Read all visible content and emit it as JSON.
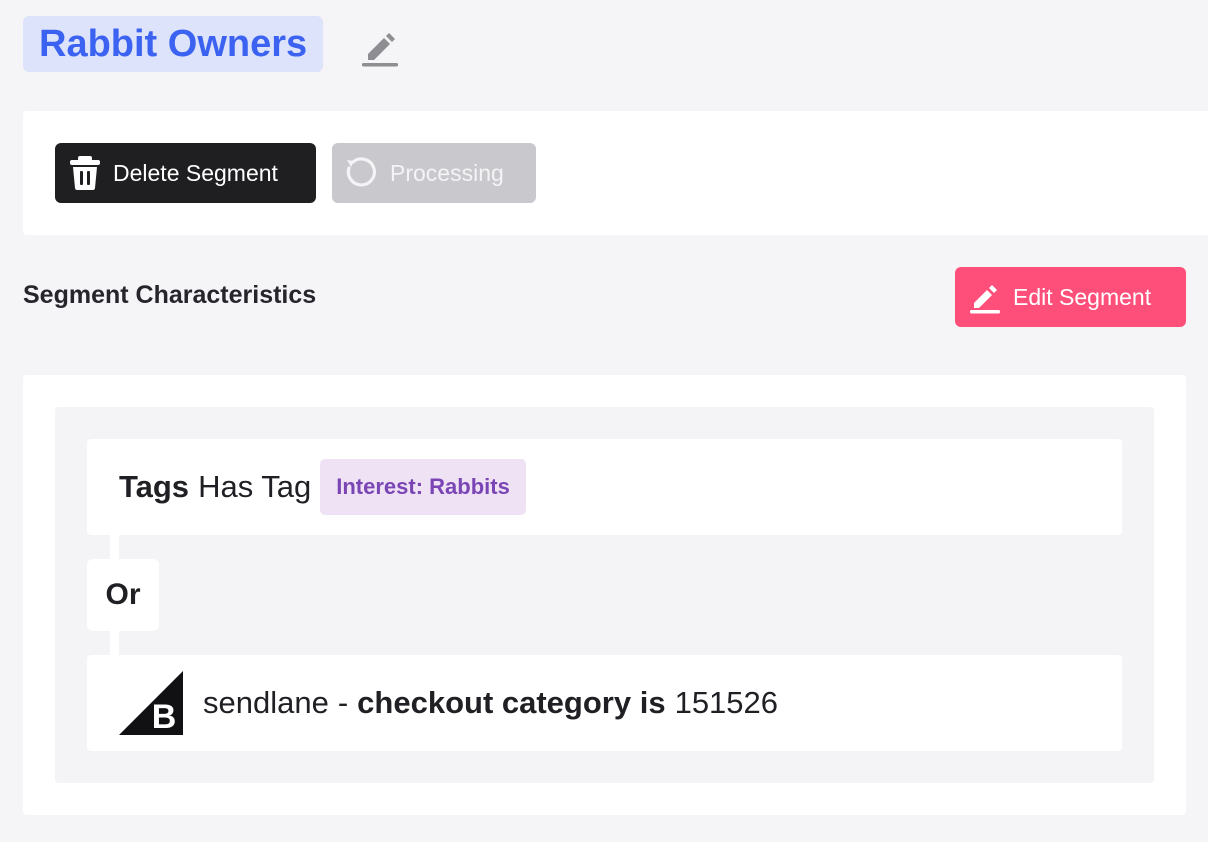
{
  "header": {
    "segment_name": "Rabbit Owners",
    "edit_name_icon": "pencil-underline-icon"
  },
  "actions": {
    "delete_label": "Delete Segment",
    "delete_icon": "trash-icon",
    "processing_label": "Processing",
    "processing_icon": "refresh-icon"
  },
  "characteristics": {
    "title": "Segment Characteristics",
    "edit_label": "Edit Segment",
    "edit_icon": "pencil-underline-icon",
    "rules": [
      {
        "field": "Tags",
        "operator": "Has Tag",
        "tag": "Interest: Rabbits"
      },
      {
        "integration_icon": "bigcommerce-logo",
        "source": "sendlane",
        "separator": "-",
        "condition": "checkout category is",
        "value": "151526"
      }
    ],
    "join_label": "Or"
  },
  "colors": {
    "page_bg": "#f5f4f7",
    "title_pill_bg": "#dde3fb",
    "title_text": "#3b62f0",
    "delete_bg": "#1f1f22",
    "processing_bg": "#c9c8cc",
    "edit_bg": "#fe4f7a",
    "tag_bg": "#efe2f5",
    "tag_text": "#7a45b5"
  }
}
